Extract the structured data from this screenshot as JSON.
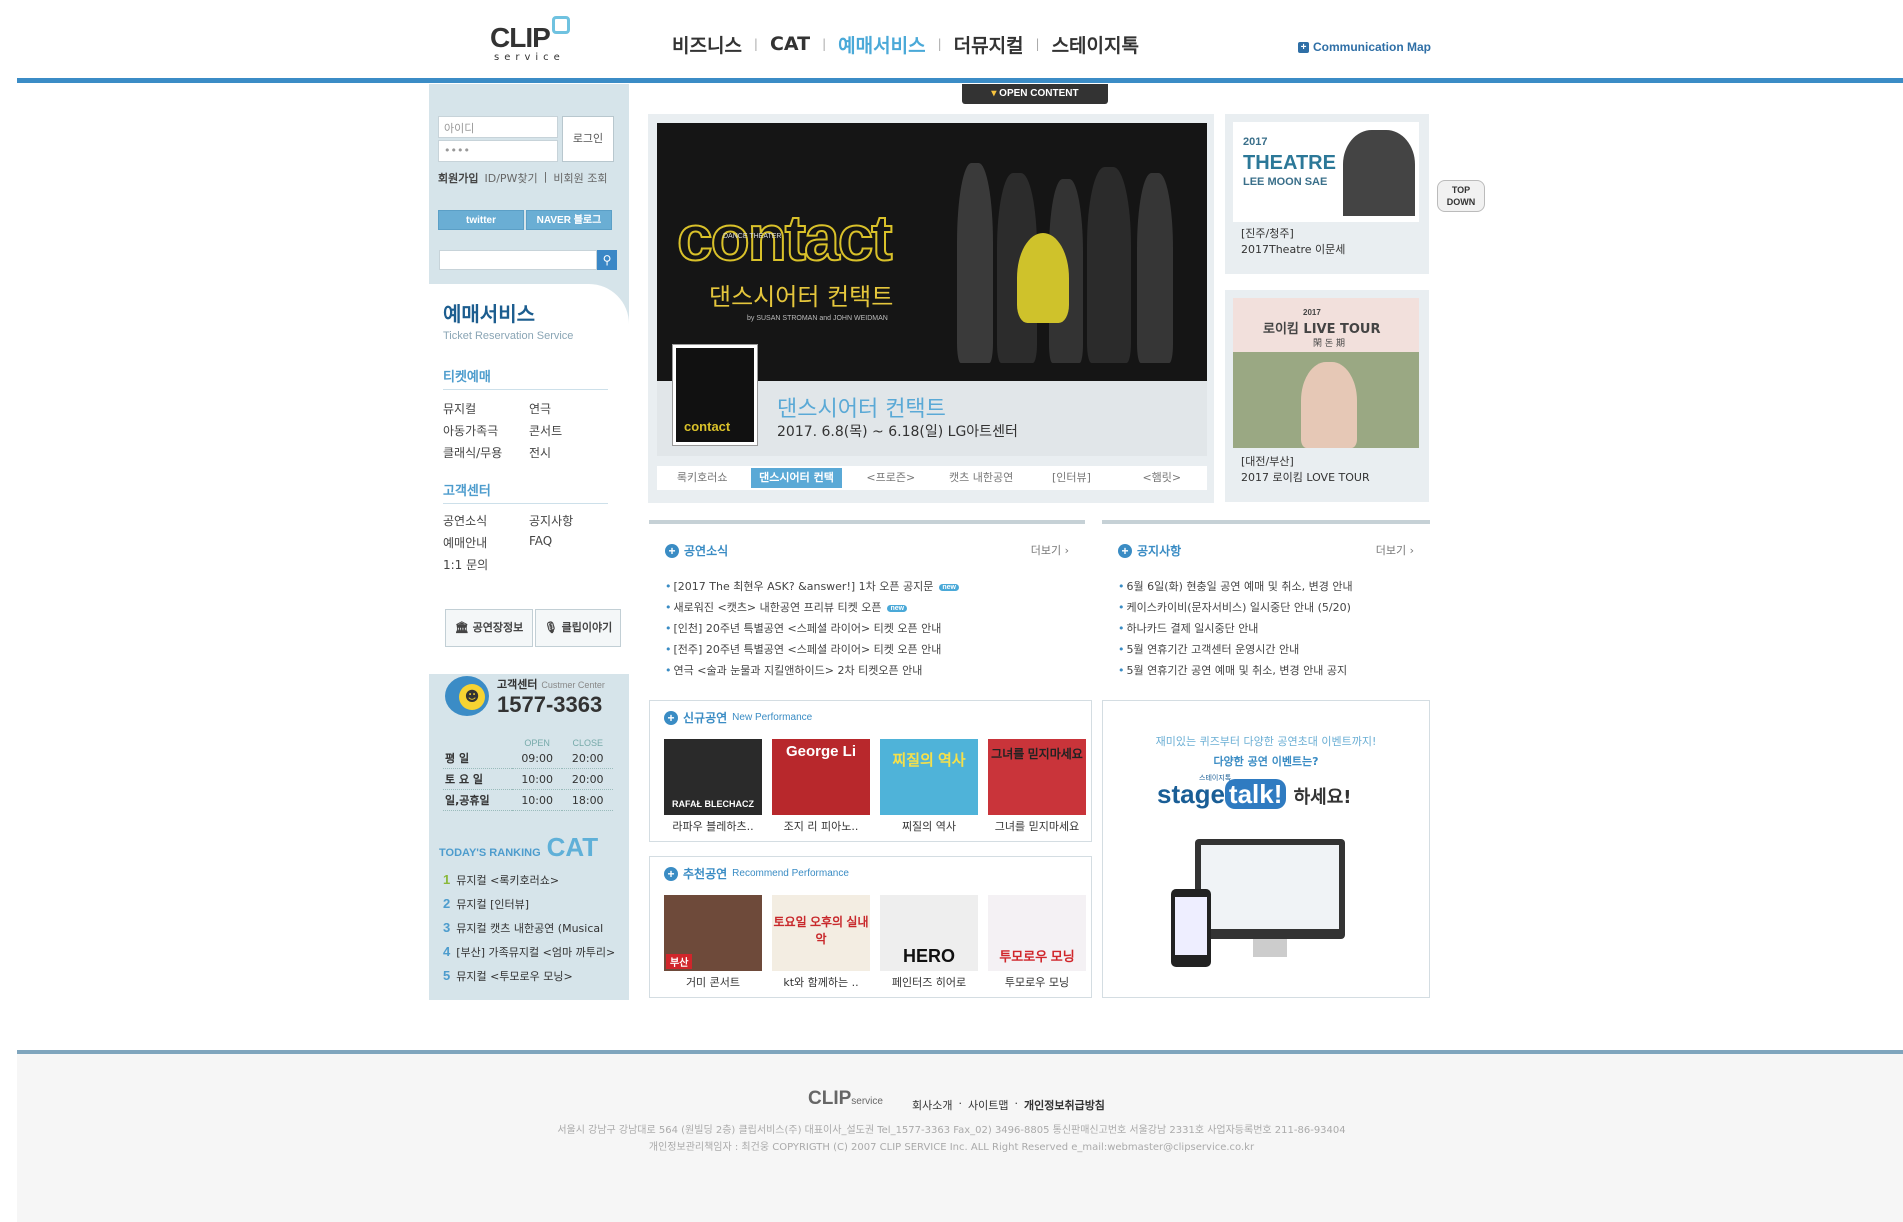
{
  "header": {
    "logo_text": "CLIP",
    "logo_sub": "service",
    "nav": [
      "비즈니스",
      "CAT",
      "예매서비스",
      "더뮤지컬",
      "스테이지톡"
    ],
    "nav_active": "예매서비스",
    "communication_map": "Communication Map",
    "accent_color": "#3b8cc6"
  },
  "left": {
    "login": {
      "id_placeholder": "아이디",
      "pw_value": "••••",
      "login_button": "로그인",
      "join": "회원가입",
      "find": "ID/PW찾기",
      "guest": "비회원 조회"
    },
    "sns": [
      "twitter",
      "NAVER 블로그"
    ],
    "service_title": "예매서비스",
    "service_sub": "Ticket Reservation Service",
    "ticket_section": "티켓예매",
    "ticket_items": [
      "뮤지컬",
      "연극",
      "아동가족극",
      "콘서트",
      "클래식/무용",
      "전시"
    ],
    "customer_section": "고객센터",
    "customer_items": [
      "공연소식",
      "공지사항",
      "예매안내",
      "FAQ",
      "1:1 문의"
    ],
    "quick_buttons": [
      "공연장정보",
      "클립이야기"
    ],
    "cc_label": "고객센터",
    "cc_label_en": "Custmer Center",
    "cc_phone": "1577-3363",
    "hours": {
      "open_label": "OPEN",
      "close_label": "CLOSE",
      "rows": [
        {
          "day": "평  일",
          "open": "09:00",
          "close": "20:00"
        },
        {
          "day": "토 요 일",
          "open": "10:00",
          "close": "20:00"
        },
        {
          "day": "일,공휴일",
          "open": "10:00",
          "close": "18:00"
        }
      ]
    },
    "ranking_label": "TODAY'S RANKING",
    "ranking_brand": "CAT",
    "ranking": [
      {
        "n": "1",
        "text": "뮤지컬 <록키호러쇼>"
      },
      {
        "n": "2",
        "text": "뮤지컬 [인터뷰]"
      },
      {
        "n": "3",
        "text": "뮤지컬 캣츠 내한공연 (Musical"
      },
      {
        "n": "4",
        "text": "[부산] 가족뮤지컬 <엄마 까투리>"
      },
      {
        "n": "5",
        "text": "뮤지컬 <투모로우 모닝>"
      }
    ]
  },
  "main": {
    "open_content": "OPEN CONTENT",
    "visual": {
      "title_en": "contact",
      "subtitle_en": "DANCE THEATER",
      "title_ko": "댄스시어터 컨택트",
      "credit": "by SUSAN STROMAN and JOHN WEIDMAN",
      "name": "댄스시어터 컨택트",
      "date": "2017. 6.8(목) ~ 6.18(일)  LG아트센터",
      "tabs": [
        "록키호러쇼",
        "댄스시어터 컨택",
        "<프로즌>",
        "캣츠 내한공연",
        "[인터뷰]",
        "<햄릿>"
      ],
      "active_tab": 1
    },
    "side_cards": [
      {
        "t1": "2017",
        "t2": "THEATRE",
        "t3": "LEE MOON SAE",
        "cap1": "[진주/청주]",
        "cap2": "2017Theatre 이문세"
      },
      {
        "t1": "2017",
        "t2": "로이킴 LIVE TOUR",
        "t3": "閑 돈 期",
        "cap1": "[대전/부산]",
        "cap2": "2017 로이킴 LOVE TOUR"
      }
    ],
    "top_down": [
      "TOP",
      "DOWN"
    ],
    "news": {
      "title": "공연소식",
      "more": "더보기",
      "items": [
        {
          "text": "[2017 The 최현우 ASK? &answer!]  1차 오픈 공지문",
          "new": "new"
        },
        {
          "text": "새로워진 <캣츠> 내한공연 프리뷰 티켓 오픈",
          "new": "new"
        },
        {
          "text": "[인천] 20주년 특별공연 <스페셜 라이어> 티켓 오픈 안내",
          "new": ""
        },
        {
          "text": "[전주] 20주년 특별공연 <스페셜 라이어> 티켓 오픈 안내",
          "new": ""
        },
        {
          "text": "연극 <술과 눈물과 지킬앤하이드> 2차 티켓오픈 안내",
          "new": ""
        }
      ]
    },
    "notice": {
      "title": "공지사항",
      "more": "더보기",
      "items": [
        "6월 6일(화) 현충일 공연 예매 및 취소, 변경 안내",
        "케이스카이비(문자서비스) 일시중단 안내 (5/20)",
        "하나카드 결제 일시중단 안내",
        "5월 연휴기간 고객센터 운영시간 안내",
        "5월 연휴기간 공연 예매 및 취소, 변경 안내 공지"
      ]
    },
    "new_perf": {
      "title": "신규공연",
      "title_en": "New Performance",
      "items": [
        {
          "name": "라파우 블레하츠..",
          "poster": "RAFAŁ BLECHACZ",
          "color": "#2a2a2a"
        },
        {
          "name": "조지 리 피아노..",
          "poster": "George Li",
          "color": "#b8282c"
        },
        {
          "name": "찌질의 역사",
          "poster": "찌질의 역사",
          "color": "#4fb3d9"
        },
        {
          "name": "그녀를 믿지마세요",
          "poster": "그녀를 믿지마세요",
          "color": "#c9343a"
        }
      ]
    },
    "rec_perf": {
      "title": "추천공연",
      "title_en": "Recommend Performance",
      "items": [
        {
          "name": "거미 콘서트",
          "poster": "부산",
          "color": "#6e4a3a"
        },
        {
          "name": "kt와 함께하는 ..",
          "poster": "토요일 오후의 실내악",
          "color": "#f3ede2"
        },
        {
          "name": "페인터즈 히어로",
          "poster": "HERO",
          "color": "#eee"
        },
        {
          "name": "투모로우 모닝",
          "poster": "투모로우 모닝",
          "color": "#f4f1f4"
        }
      ]
    },
    "stagetalk": {
      "line1": "재미있는 퀴즈부터 다양한 공연초대 이벤트까지!",
      "line2": "다양한 공연 이벤트는?",
      "logo_a": "stage",
      "logo_b": "talk!",
      "logo_ko": "스테이지톡",
      "suffix": "하세요!"
    }
  },
  "footer": {
    "logo": "CLIP",
    "logo_sub": "service",
    "links": [
      "회사소개",
      "사이트맵",
      "개인정보취급방침"
    ],
    "addr1": "서울시 강남구 강남대로 564 (원빌딩 2층) 클립서비스(주) 대표이사_설도권 Tel_1577-3363 Fax_02) 3496-8805 통신판매신고번호 서울강남 2331호 사업자등록번호 211-86-93404",
    "addr2": "개인정보관리책임자 : 최건웅 COPYRIGTH (C) 2007 CLIP SERVICE Inc. ALL Right Reserved e_mail:webmaster@clipservice.co.kr"
  }
}
